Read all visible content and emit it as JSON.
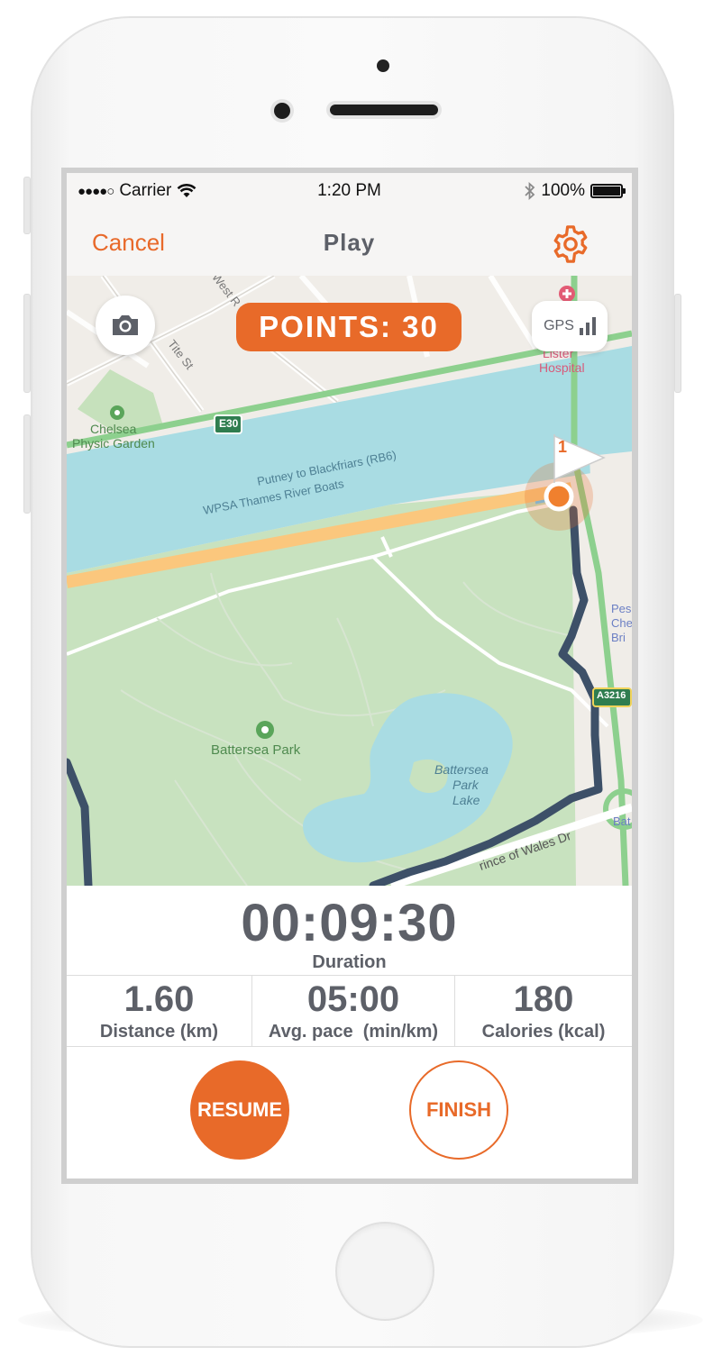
{
  "status_bar": {
    "signal": "●●●●○",
    "carrier": "Carrier",
    "time": "1:20 PM",
    "battery_percent": "100%",
    "icons": [
      "wifi-icon",
      "bluetooth-icon",
      "battery-icon"
    ]
  },
  "nav": {
    "cancel_label": "Cancel",
    "title": "Play",
    "settings_icon": "gear-icon"
  },
  "map": {
    "points_label": "POINTS: 30",
    "gps_label": "GPS",
    "camera_icon": "camera-icon",
    "labels": {
      "west_rd": "West R",
      "tite_st": "Tite St",
      "chelsea_garden_1": "Chelsea",
      "chelsea_garden_2": "Physic Garden",
      "e30": "E30",
      "lister_1": "Lister",
      "lister_2": "Hospital",
      "putney": "Putney to Blackfriars (RB6)",
      "wpsa": "WPSA Thames River Boats",
      "battersea_park": "Battersea Park",
      "lake_1": "Battersea",
      "lake_2": "Park",
      "lake_3": "Lake",
      "a3216": "A3216",
      "pes_1": "Pes",
      "pes_2": "Che",
      "pes_3": "Bri",
      "bat": "Bat",
      "wales_dr": "rince of Wales Dr",
      "flag_number": "1"
    }
  },
  "stats": {
    "duration_value": "00:09:30",
    "duration_label": "Duration",
    "distance_value": "1.60",
    "distance_label": "Distance (km)",
    "pace_value": "05:00",
    "pace_label": "Avg. pace  (min/km)",
    "calories_value": "180",
    "calories_label": "Calories (kcal)"
  },
  "actions": {
    "resume_label": "RESUME",
    "finish_label": "FINISH"
  },
  "colors": {
    "accent": "#e86a29",
    "text_gray": "#5d6068",
    "water": "#a9dce3",
    "park": "#c8e2bf",
    "route": "#3d5068"
  }
}
